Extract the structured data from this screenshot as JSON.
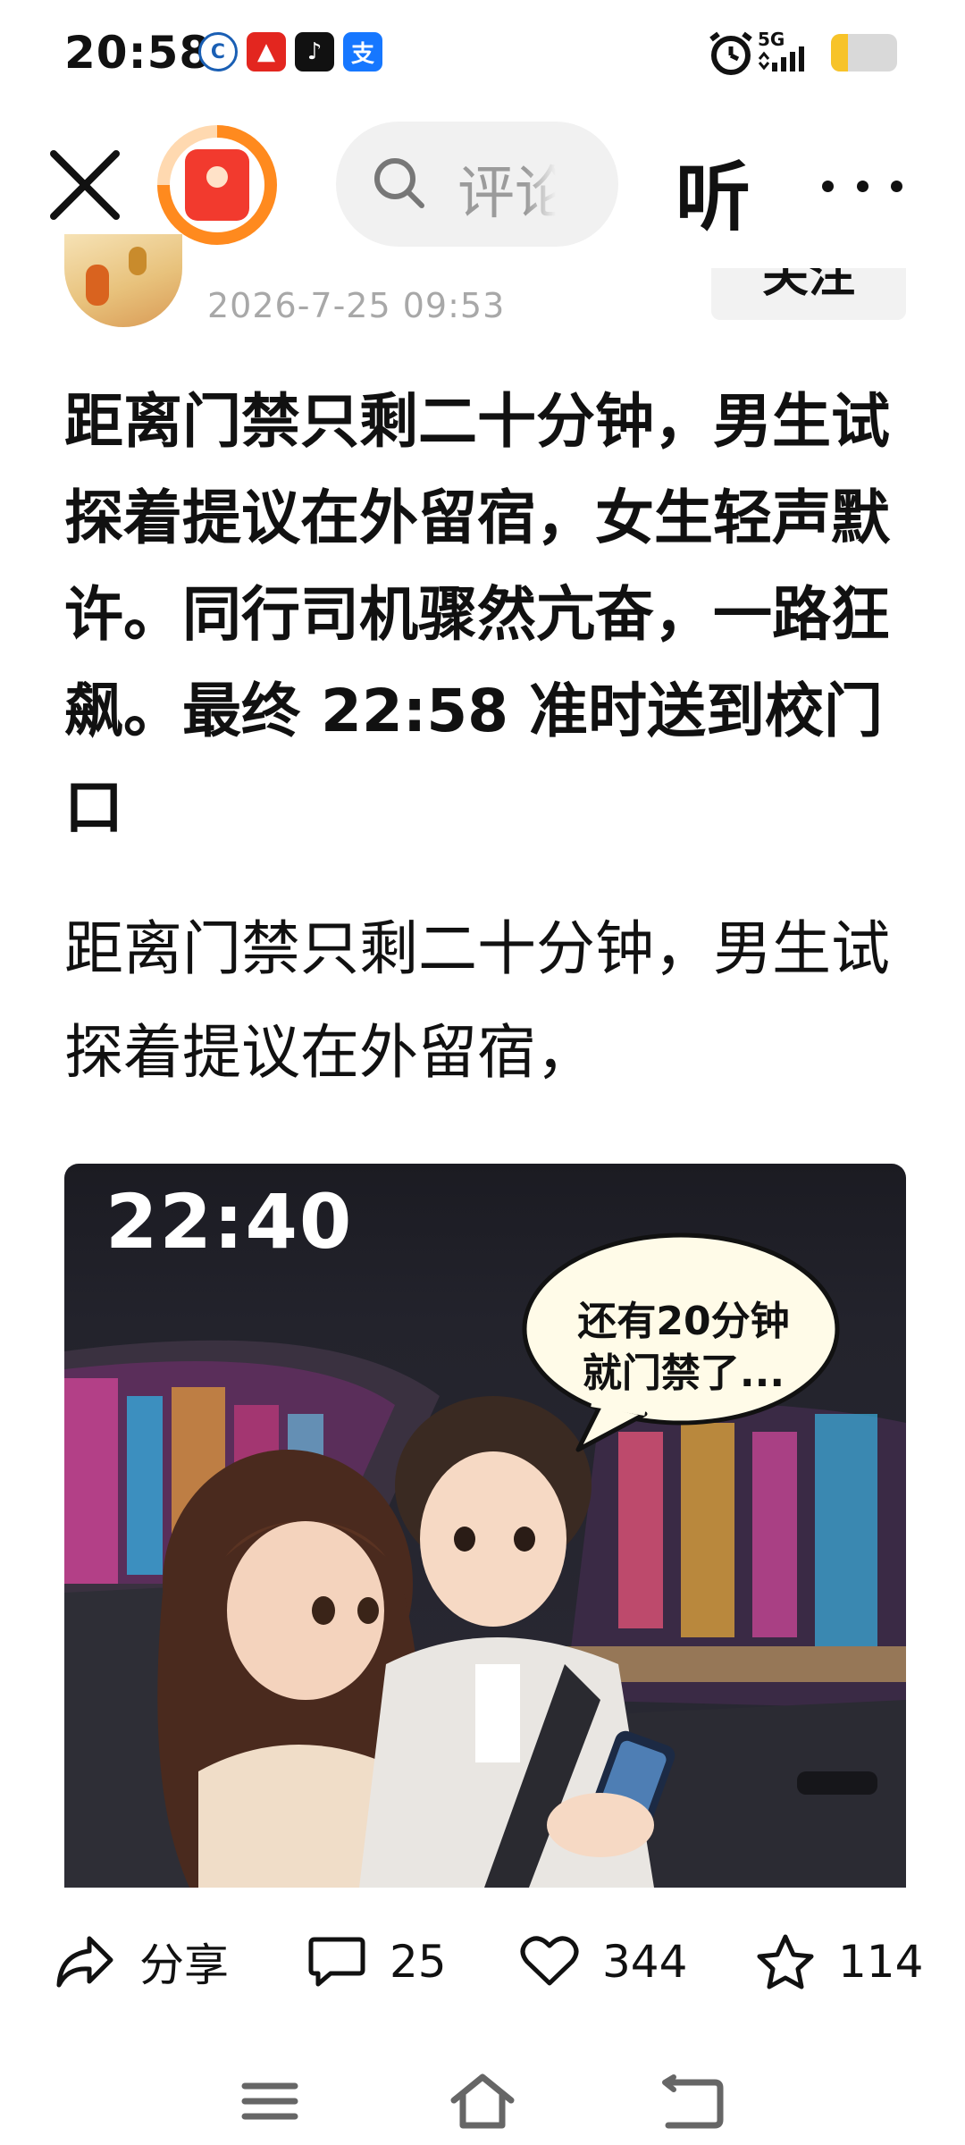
{
  "status_bar": {
    "time": "20:58",
    "network": "5G",
    "app_icons": [
      "bank-icon",
      "red-app-icon",
      "tiktok-icon",
      "alipay-icon"
    ],
    "battery_level": 0.25,
    "colors": {
      "battery_fill": "#f7c329"
    }
  },
  "toolbar": {
    "search_placeholder": "评论",
    "listen_label": "听",
    "redpacket_progress": 0.75,
    "colors": {
      "ring": "#ff8a1e",
      "envelope": "#f23a2e"
    }
  },
  "author": {
    "date": "2026-7-25 09:53",
    "follow_label": "关注"
  },
  "article": {
    "title": "距离门禁只剩二十分钟，男生试探着提议在外留宿，女生轻声默许。同行司机骤然亢奋，一路狂飙。最终 22:58 准时送到校门口",
    "excerpt": "距离门禁只剩二十分钟，男生试探着提议在外留宿，"
  },
  "illustration": {
    "clock": "22:40",
    "speech_bubble": "还有20分钟\n就门禁了..."
  },
  "actions": {
    "share_label": "分享",
    "comments": "25",
    "likes": "344",
    "favorites": "114"
  },
  "nav_icons": [
    "menu-icon",
    "home-icon",
    "back-icon"
  ]
}
